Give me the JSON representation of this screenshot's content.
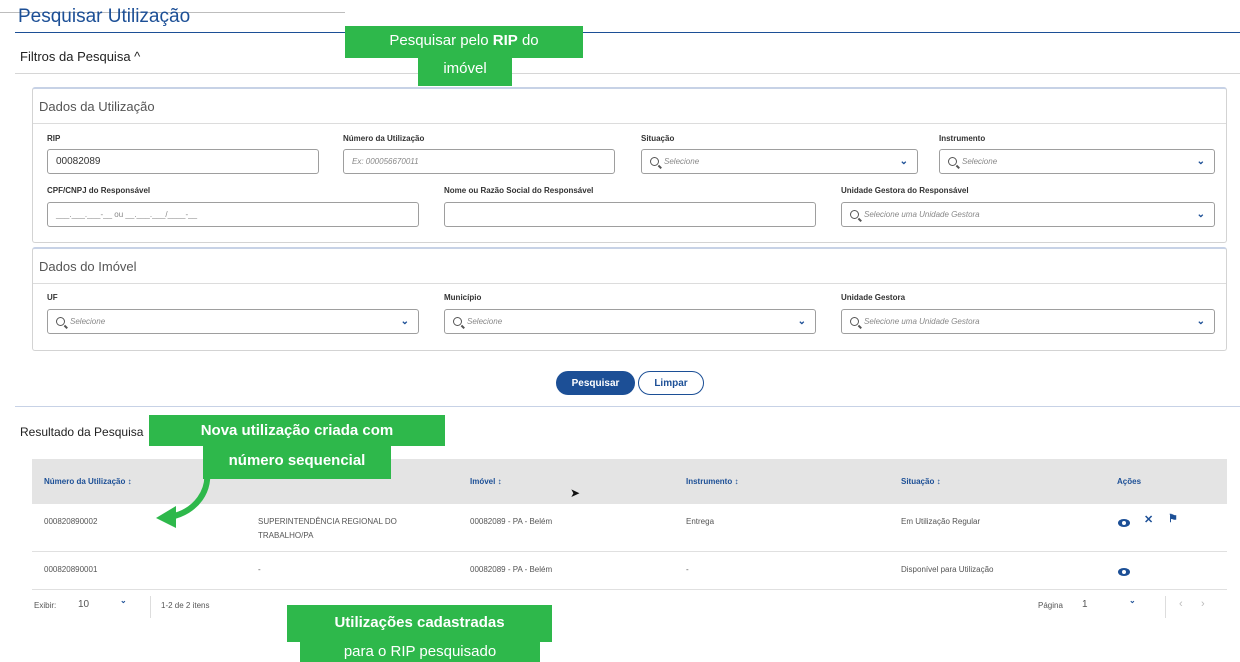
{
  "page": {
    "title": "Pesquisar Utilização",
    "filters_toggle": "Filtros da Pesquisa ^"
  },
  "utilizacao_section": {
    "title": "Dados da Utilização",
    "rip": {
      "label": "RIP",
      "value": "00082089"
    },
    "numero": {
      "label": "Número da Utilização",
      "placeholder": "Ex: 000056670011"
    },
    "situacao": {
      "label": "Situação",
      "placeholder": "Selecione"
    },
    "instrumento": {
      "label": "Instrumento",
      "placeholder": "Selecione"
    },
    "cpf": {
      "label": "CPF/CNPJ do Responsável",
      "placeholder": "___.___.___-__ ou __.___.___/____-__"
    },
    "nome": {
      "label": "Nome ou Razão Social do Responsável",
      "value": ""
    },
    "unidade": {
      "label": "Unidade Gestora do Responsável",
      "placeholder": "Selecione uma Unidade Gestora"
    }
  },
  "imovel_section": {
    "title": "Dados do Imóvel",
    "uf": {
      "label": "UF",
      "placeholder": "Selecione"
    },
    "municipio": {
      "label": "Município",
      "placeholder": "Selecione"
    },
    "unidade": {
      "label": "Unidade Gestora",
      "placeholder": "Selecione uma Unidade Gestora"
    }
  },
  "buttons": {
    "search": "Pesquisar",
    "clear": "Limpar"
  },
  "results": {
    "title": "Resultado da Pesquisa",
    "columns": [
      "Número da Utilização ↕",
      "Imóvel ↕",
      "Instrumento ↕",
      "Situação ↕",
      "Ações"
    ],
    "rows": [
      {
        "numero": "000820890002",
        "responsavel": "SUPERINTENDÊNCIA REGIONAL DO TRABALHO/PA",
        "imovel": "00082089 - PA - Belém",
        "instrumento": "Entrega",
        "situacao": "Em Utilização Regular",
        "actions": [
          "eye-icon",
          "close-icon",
          "flag-icon"
        ]
      },
      {
        "numero": "000820890001",
        "responsavel": "-",
        "imovel": "00082089 - PA - Belém",
        "instrumento": "-",
        "situacao": "Disponível para Utilização",
        "actions": [
          "eye-icon"
        ]
      }
    ]
  },
  "pager": {
    "show_label": "Exibir:",
    "page_size": "10",
    "count": "1-2 de 2 itens",
    "page_label": "Página",
    "page": "1"
  },
  "callouts": {
    "rip_line1_pre": "Pesquisar pelo ",
    "rip_line1_bold": "RIP",
    "rip_line1_post": " do",
    "rip_line2": "imóvel",
    "nova_line1": "Nova utilização criada com",
    "nova_line2": "número sequencial",
    "cad_line1": "Utilizações cadastradas",
    "cad_line2": "para o RIP pesquisado"
  },
  "colors": {
    "primary": "#1c4f96",
    "callout": "#2eb84b"
  }
}
